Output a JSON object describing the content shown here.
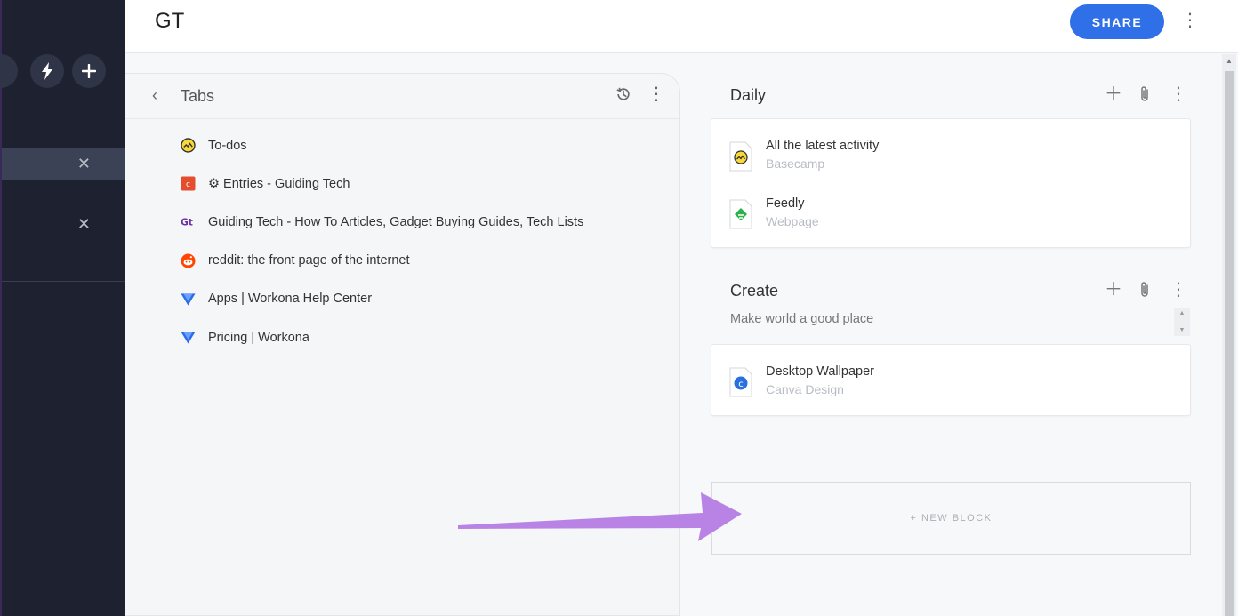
{
  "header": {
    "title": "GT",
    "share_label": "SHARE"
  },
  "sidebar": {
    "close_glyph": "✕"
  },
  "tabs_panel": {
    "back_glyph": "‹",
    "title": "Tabs",
    "items": [
      {
        "label": "To-dos",
        "favicon": "basecamp"
      },
      {
        "label": "⚙ Entries - Guiding Tech",
        "favicon": "craft-c"
      },
      {
        "label": "Guiding Tech - How To Articles, Gadget Buying Guides, Tech Lists",
        "favicon": "guiding-tech"
      },
      {
        "label": "reddit: the front page of the internet",
        "favicon": "reddit"
      },
      {
        "label": "Apps | Workona Help Center",
        "favicon": "workona"
      },
      {
        "label": "Pricing | Workona",
        "favicon": "workona"
      }
    ]
  },
  "blocks": [
    {
      "title": "Daily",
      "items": [
        {
          "title": "All the latest activity",
          "subtitle": "Basecamp",
          "icon": "basecamp"
        },
        {
          "title": "Feedly",
          "subtitle": "Webpage",
          "icon": "feedly"
        }
      ]
    },
    {
      "title": "Create",
      "description": "Make world a good place",
      "items": [
        {
          "title": "Desktop Wallpaper",
          "subtitle": "Canva Design",
          "icon": "canva"
        }
      ]
    }
  ],
  "new_block_label": "+ NEW BLOCK",
  "colors": {
    "accent": "#2f6fe8",
    "sidebar": "#1e2230",
    "arrow": "#b983e6"
  }
}
